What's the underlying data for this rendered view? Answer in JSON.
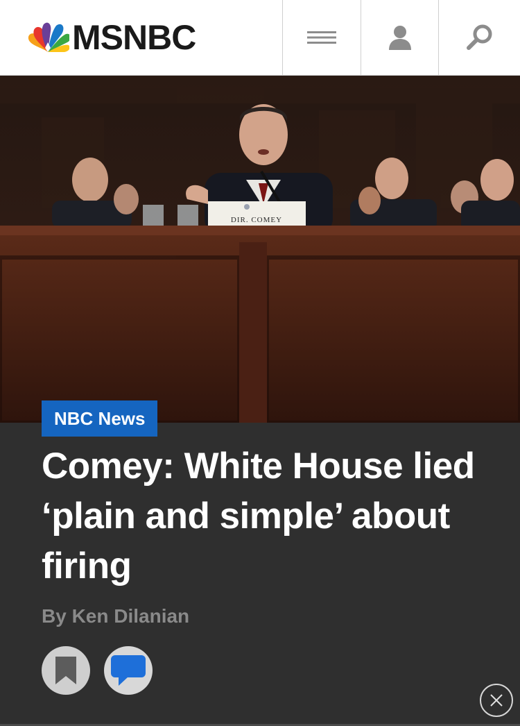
{
  "header": {
    "logo_text": "MSNBC",
    "icons": {
      "menu": "hamburger-menu-icon",
      "user": "user-icon",
      "search": "search-icon"
    }
  },
  "hero": {
    "nameplate_text": "DIR. COMEY"
  },
  "article": {
    "source": "NBC News",
    "headline": "Comey: White House lied ‘plain and simple’ about firing",
    "byline": "By Ken Dilanian"
  },
  "actions": {
    "icons": {
      "bookmark": "bookmark-icon",
      "comment": "comment-icon",
      "close": "close-icon"
    }
  },
  "colors": {
    "header_bg": "#ffffff",
    "panel_bg": "#2f2f2f",
    "badge_blue": "#1565c0",
    "comment_blue": "#1e6fd9",
    "byline_gray": "#8a8a8a"
  }
}
